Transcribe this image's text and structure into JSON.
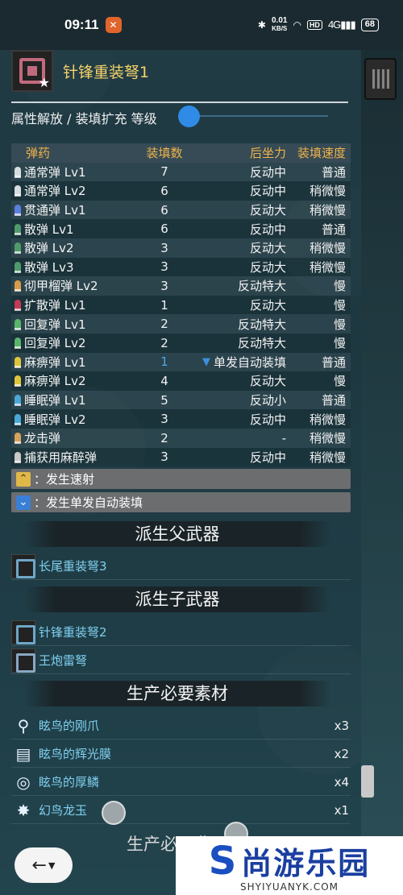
{
  "status": {
    "time": "09:11",
    "net_speed_value": "0.01",
    "net_speed_unit": "KB/S",
    "hd": "HD",
    "signal": "4G",
    "battery": "68"
  },
  "weapon": {
    "name": "针锋重装弩1",
    "level_label": "属性解放 / 装填扩充 等级",
    "level_value": 0
  },
  "ammo_table": {
    "headers": [
      "弹药",
      "装填数",
      "后坐力",
      "装填速度"
    ],
    "rows": [
      {
        "name": "通常弹 Lv1",
        "count": "7",
        "recoil": "反动中",
        "speed": "普通",
        "color": "#d8dde0"
      },
      {
        "name": "通常弹 Lv2",
        "count": "6",
        "recoil": "反动中",
        "speed": "稍微慢",
        "color": "#d8dde0"
      },
      {
        "name": "贯通弹 Lv1",
        "count": "6",
        "recoil": "反动大",
        "speed": "稍微慢",
        "color": "#5a7fe0"
      },
      {
        "name": "散弹 Lv1",
        "count": "6",
        "recoil": "反动中",
        "speed": "普通",
        "color": "#4f9a6a"
      },
      {
        "name": "散弹 Lv2",
        "count": "3",
        "recoil": "反动大",
        "speed": "稍微慢",
        "color": "#4f9a6a"
      },
      {
        "name": "散弹 Lv3",
        "count": "3",
        "recoil": "反动大",
        "speed": "稍微慢",
        "color": "#4f9a6a"
      },
      {
        "name": "彻甲榴弹 Lv2",
        "count": "3",
        "recoil": "反动特大",
        "speed": "慢",
        "color": "#d99a4a"
      },
      {
        "name": "扩散弹 Lv1",
        "count": "1",
        "recoil": "反动大",
        "speed": "慢",
        "color": "#c43a55"
      },
      {
        "name": "回复弹 Lv1",
        "count": "2",
        "recoil": "反动特大",
        "speed": "慢",
        "color": "#58b56a"
      },
      {
        "name": "回复弹 Lv2",
        "count": "2",
        "recoil": "反动特大",
        "speed": "慢",
        "color": "#58b56a"
      },
      {
        "name": "麻痹弹 Lv1",
        "count": "1",
        "recoil": "单发自动装填",
        "speed": "普通",
        "color": "#e0c43a",
        "auto_reload": true
      },
      {
        "name": "麻痹弹 Lv2",
        "count": "4",
        "recoil": "反动大",
        "speed": "慢",
        "color": "#e0c43a"
      },
      {
        "name": "睡眠弹 Lv1",
        "count": "5",
        "recoil": "反动小",
        "speed": "普通",
        "color": "#4aa8d8"
      },
      {
        "name": "睡眠弹 Lv2",
        "count": "3",
        "recoil": "反动中",
        "speed": "稍微慢",
        "color": "#4aa8d8"
      },
      {
        "name": "龙击弹",
        "count": "2",
        "recoil": "-",
        "speed": "稍微慢",
        "color": "#d9a25a"
      },
      {
        "name": "捕获用麻醉弹",
        "count": "3",
        "recoil": "反动中",
        "speed": "稍微慢",
        "color": "#c8c8c8"
      }
    ]
  },
  "legend": {
    "rapid_fire": "：发生速射",
    "auto_reload": "：发生单发自动装填"
  },
  "sections": {
    "parent_title": "派生父武器",
    "child_title": "派生子武器",
    "materials_title": "生产必要素材",
    "cost_title": "生产必要费用"
  },
  "parent_weapons": [
    {
      "name": "长尾重装弩3"
    }
  ],
  "child_weapons": [
    {
      "name": "针锋重装弩2"
    },
    {
      "name": "王炮雷弩"
    }
  ],
  "materials": [
    {
      "name": "眩鸟的刚爪",
      "qty": "x3",
      "icon": "claw-icon"
    },
    {
      "name": "眩鸟的辉光膜",
      "qty": "x2",
      "icon": "membrane-icon"
    },
    {
      "name": "眩鸟的厚鳞",
      "qty": "x4",
      "icon": "scale-icon"
    },
    {
      "name": "幻鸟龙玉",
      "qty": "x1",
      "icon": "gem-icon"
    }
  ],
  "watermark": {
    "brand": "尚游乐园",
    "url": "SHYIYUANYK.COM"
  }
}
